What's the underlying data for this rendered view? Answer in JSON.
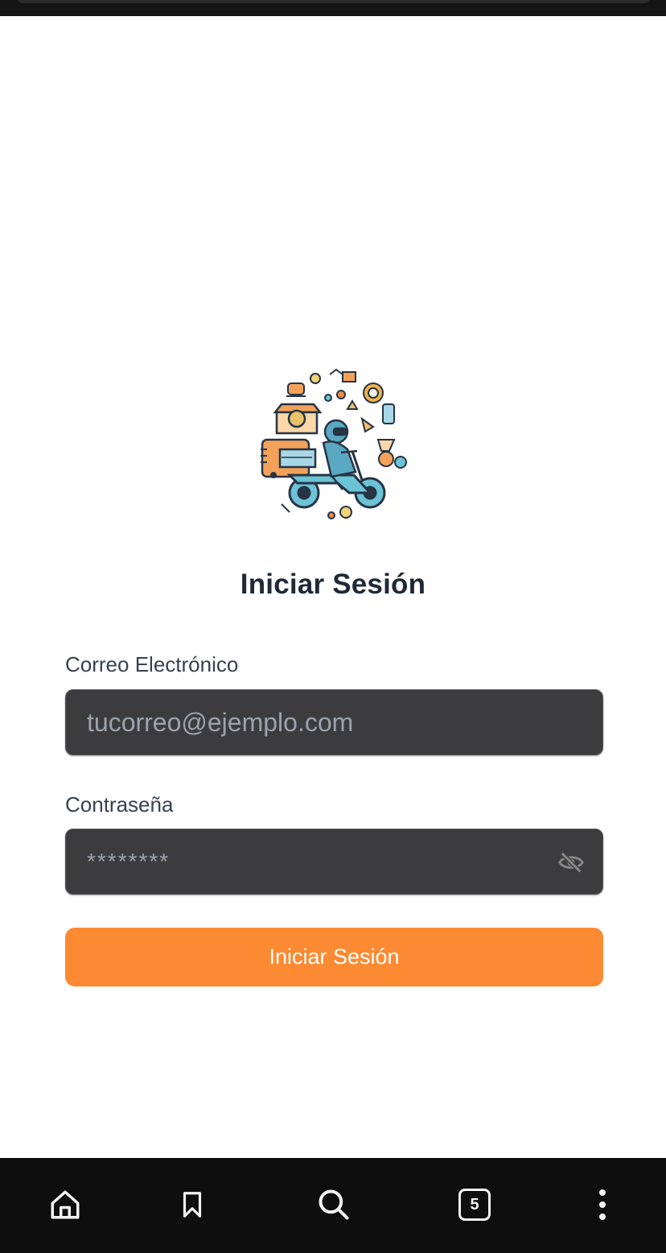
{
  "login": {
    "title": "Iniciar Sesión",
    "email_label": "Correo Electrónico",
    "email_placeholder": "tucorreo@ejemplo.com",
    "password_label": "Contraseña",
    "password_placeholder": "********",
    "submit_label": "Iniciar Sesión"
  },
  "browser_nav": {
    "tab_count": "5"
  },
  "colors": {
    "accent": "#fb8a32",
    "field_bg": "#3c3c3e",
    "nav_bg": "#0e0e0e"
  },
  "icons": {
    "logo": "delivery-motorcycle-logo",
    "password_toggle": "eye-off-icon",
    "home": "home-icon",
    "bookmark": "bookmark-icon",
    "search": "search-icon",
    "tabs": "tabs-icon",
    "menu": "more-vertical-icon"
  }
}
